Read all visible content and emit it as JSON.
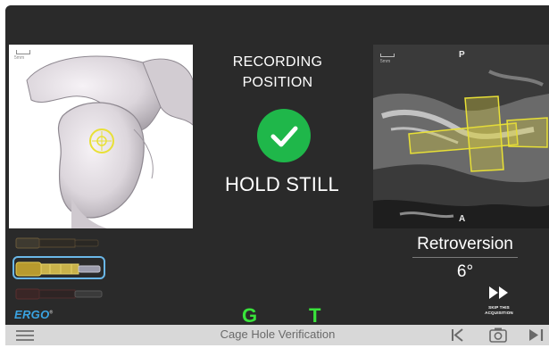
{
  "status": {
    "title_line1": "RECORDING",
    "title_line2": "POSITION",
    "message": "HOLD STILL"
  },
  "left_view": {
    "scale_label": "5mm"
  },
  "ct_view": {
    "posterior_marker": "P",
    "anterior_marker": "A",
    "scale_label": "5mm"
  },
  "retroversion": {
    "label": "Retroversion",
    "value": "6°"
  },
  "skip": {
    "label_line1": "SKIP THIS",
    "label_line2": "ACQUISITION",
    "icon": "fast-forward-icon"
  },
  "implants": [
    {
      "name": "implant-option-1",
      "color": "#6b5a3a",
      "selected": false
    },
    {
      "name": "implant-option-2",
      "color": "#c9b24a",
      "selected": true
    },
    {
      "name": "implant-option-3",
      "color": "#5a2e2e",
      "selected": false
    }
  ],
  "brand": {
    "name": "ERGO",
    "mark": "®"
  },
  "trackers": {
    "g": "G",
    "t": "T",
    "color": "#39e33b"
  },
  "bottom_bar": {
    "title": "Cage Hole Verification",
    "menu_icon": "hamburger-menu-icon",
    "prev_icon": "previous-step-icon",
    "camera_icon": "camera-icon",
    "next_icon": "next-step-icon"
  },
  "colors": {
    "background": "#2a2a2a",
    "success": "#1fb74a",
    "highlight": "#e8e036",
    "selection": "#6ab7e8",
    "brand": "#3aa3e2"
  }
}
